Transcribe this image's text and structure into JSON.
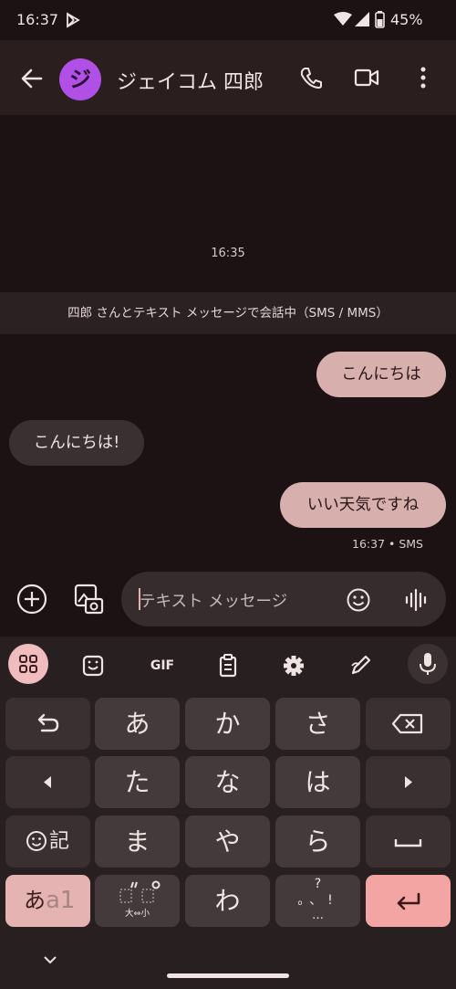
{
  "status_bar": {
    "time": "16:37",
    "battery": "45%"
  },
  "app_bar": {
    "avatar_letter": "ジ",
    "contact_name": "ジェイコム 四郎"
  },
  "conversation": {
    "time_label": "16:35",
    "banner": "四郎 さんとテキスト メッセージで会話中（SMS / MMS）",
    "messages": [
      {
        "direction": "outgoing",
        "text": "こんにちは"
      },
      {
        "direction": "incoming",
        "text": "こんにちは!"
      },
      {
        "direction": "outgoing",
        "text": "いい天気ですね"
      }
    ],
    "last_meta": "16:37 • SMS"
  },
  "compose": {
    "placeholder": "テキスト メッセージ"
  },
  "keyboard": {
    "toolbar_gif": "GIF",
    "rows": [
      [
        "undo",
        "あ",
        "か",
        "さ",
        "backspace"
      ],
      [
        "left",
        "た",
        "な",
        "は",
        "right"
      ],
      [
        "emoji-kigou",
        "ま",
        "や",
        "ら",
        "space"
      ],
      [
        "mode",
        "dakuten",
        "わ",
        "punct",
        "enter"
      ]
    ],
    "emoji_key_label": "記",
    "mode_key_main": "あ",
    "mode_key_sub": "a1",
    "dakuten_small": "大⇔小",
    "punct_top": "?",
    "punct_bottom": "。、!",
    "punct_ellipsis": "…"
  },
  "colors": {
    "background": "#1c1213",
    "outgoing_bubble": "#d7b0ae",
    "incoming_bubble": "#3b3031",
    "accent": "#f0bcbd",
    "enter_key": "#f2a5a2"
  }
}
